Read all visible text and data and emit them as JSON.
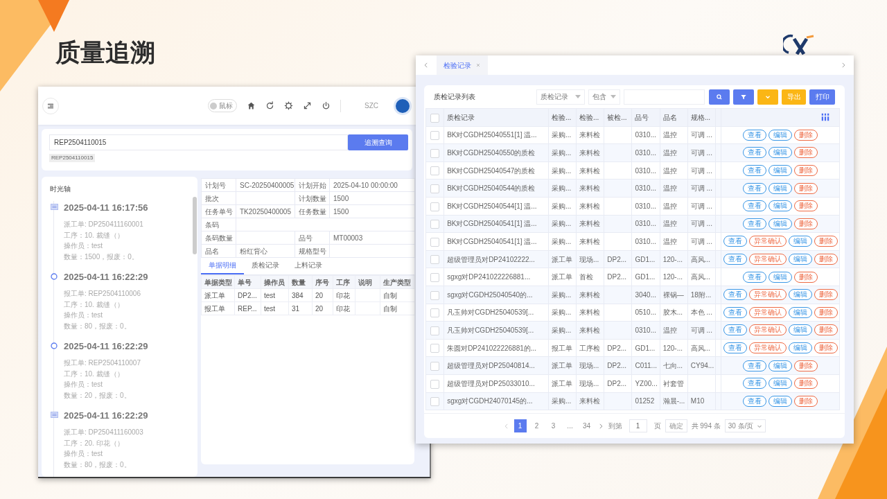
{
  "slide": {
    "title": "质量追溯"
  },
  "left_window": {
    "header": {
      "toggle": {
        "label": "鼠标",
        "on": false
      },
      "user": "SZC"
    },
    "search": {
      "value": "REP2504110015",
      "button": "追溯查询",
      "tags": [
        "REP2504110015"
      ]
    },
    "timeline": {
      "title": "时光轴",
      "items": [
        {
          "kind": "square",
          "time": "2025-04-11 16:17:56",
          "lines": [
            "派工单: DP250411160001",
            "工序：10. 裁缝（）",
            "操作员：test",
            "数量：1500，报废：0。"
          ]
        },
        {
          "kind": "circle",
          "time": "2025-04-11 16:22:29",
          "lines": [
            "报工单: REP2504110006",
            "工序：10. 裁缝（）",
            "操作员：test",
            "数量：80，报废：0。"
          ]
        },
        {
          "kind": "circle",
          "time": "2025-04-11 16:22:29",
          "lines": [
            "报工单: REP2504110007",
            "工序：10. 裁缝（）",
            "操作员：test",
            "数量：20，报废：0。"
          ]
        },
        {
          "kind": "square",
          "time": "2025-04-11 16:22:29",
          "lines": [
            "派工单: DP250411160003",
            "工序：20. 印花（）",
            "操作员：test",
            "数量：80，报废：0。"
          ]
        }
      ]
    },
    "info_table": {
      "rows": [
        [
          {
            "label": "计划号",
            "value": "SC-20250400005"
          },
          {
            "label": "计划开始",
            "value": "2025-04-10 00:00:00"
          }
        ],
        [
          {
            "label": "批次"
          },
          {
            "label": "计划数量",
            "value": "1500"
          }
        ],
        [
          {
            "label": "任务单号",
            "value": "TK20250400005"
          },
          {
            "label": "任务数量",
            "value": "1500"
          }
        ],
        [
          {
            "label": "条码"
          }
        ],
        [
          {
            "label": "条码数量"
          },
          {
            "label": "品号",
            "value": "MT00003"
          }
        ],
        [
          {
            "label": "品名",
            "value": "粉红背心"
          },
          {
            "label": "规格型号"
          }
        ]
      ]
    },
    "tabs": [
      {
        "label": "单据明细",
        "selected": true
      },
      {
        "label": "质检记录",
        "selected": false
      },
      {
        "label": "上料记录",
        "selected": false
      }
    ],
    "detail_table": {
      "columns": [
        "单据类型",
        "单号",
        "操作员",
        "数量",
        "序号",
        "工序",
        "说明",
        "生产类型"
      ],
      "rows": [
        [
          "派工单",
          "DP2...",
          "test",
          "384",
          "20",
          "印花",
          null,
          "自制"
        ],
        [
          "报工单",
          "REP...",
          "test",
          "31",
          "20",
          "印花",
          null,
          "自制"
        ]
      ]
    }
  },
  "right_window": {
    "tabs": [
      {
        "label": "检验记录",
        "selected": true
      }
    ],
    "toolbar": {
      "title": "质检记录列表",
      "field_select": "质检记录",
      "operator_select": "包含",
      "buttons": [
        {
          "kind": "search",
          "color": "#5b7bef"
        },
        {
          "kind": "filter",
          "color": "#5b7bef"
        },
        {
          "kind": "expand",
          "color": "#fbb615"
        },
        {
          "kind": "export",
          "label": "导出",
          "color": "#fbb615"
        },
        {
          "kind": "print",
          "label": "打印",
          "color": "#5b7bef"
        }
      ]
    },
    "table": {
      "select_all_checked": false,
      "columns": [
        "质检记录",
        "检验...",
        "检验...",
        "被检...",
        "品号",
        "品名",
        "规格..."
      ],
      "rows": [
        {
          "checked": false,
          "cells": [
            "BK对CGDH25040551[1] 温...",
            "采购...",
            "来料检",
            null,
            "0310...",
            "温控",
            "可调 ..."
          ],
          "actions": [
            {
              "label": "查看",
              "kind": "view"
            },
            {
              "label": "编辑",
              "kind": "edit"
            },
            {
              "label": "删除",
              "kind": "delete"
            }
          ]
        },
        {
          "checked": false,
          "cells": [
            "BK对CGDH25040550的质检",
            "采购...",
            "来料检",
            null,
            "0310...",
            "温控",
            "可调 ..."
          ],
          "actions": [
            {
              "label": "查看",
              "kind": "view"
            },
            {
              "label": "编辑",
              "kind": "edit"
            },
            {
              "label": "删除",
              "kind": "delete"
            }
          ]
        },
        {
          "checked": false,
          "cells": [
            "BK对CGDH25040547的质检",
            "采购...",
            "来料检",
            null,
            "0310...",
            "温控",
            "可调 ..."
          ],
          "actions": [
            {
              "label": "查看",
              "kind": "view"
            },
            {
              "label": "编辑",
              "kind": "edit"
            },
            {
              "label": "删除",
              "kind": "delete"
            }
          ]
        },
        {
          "checked": false,
          "cells": [
            "BK对CGDH25040544的质检",
            "采购...",
            "来料检",
            null,
            "0310...",
            "温控",
            "可调 ..."
          ],
          "actions": [
            {
              "label": "查看",
              "kind": "view"
            },
            {
              "label": "编辑",
              "kind": "edit"
            },
            {
              "label": "删除",
              "kind": "delete"
            }
          ]
        },
        {
          "checked": false,
          "cells": [
            "BK对CGDH25040544[1] 温...",
            "采购...",
            "来料检",
            null,
            "0310...",
            "温控",
            "可调 ..."
          ],
          "actions": [
            {
              "label": "查看",
              "kind": "view"
            },
            {
              "label": "编辑",
              "kind": "edit"
            },
            {
              "label": "删除",
              "kind": "delete"
            }
          ]
        },
        {
          "checked": false,
          "cells": [
            "BK对CGDH25040541[1] 温...",
            "采购...",
            "来料检",
            null,
            "0310...",
            "温控",
            "可调 ..."
          ],
          "actions": [
            {
              "label": "查看",
              "kind": "view"
            },
            {
              "label": "编辑",
              "kind": "edit"
            },
            {
              "label": "删除",
              "kind": "delete"
            }
          ]
        },
        {
          "checked": false,
          "cells": [
            "BK对CGDH25040541[1] 温...",
            "采购...",
            "来料检",
            null,
            "0310...",
            "温控",
            "可调 ..."
          ],
          "actions": [
            {
              "label": "查看",
              "kind": "view"
            },
            {
              "label": "异常确认",
              "kind": "confirm"
            },
            {
              "label": "编辑",
              "kind": "edit"
            },
            {
              "label": "删除",
              "kind": "delete"
            }
          ]
        },
        {
          "checked": false,
          "cells": [
            "超级管理员对DP24102222...",
            "派工单",
            "现场...",
            "DP2...",
            "GD1...",
            "120-...",
            "高风..."
          ],
          "actions": [
            {
              "label": "查看",
              "kind": "view"
            },
            {
              "label": "异常确认",
              "kind": "confirm"
            },
            {
              "label": "编辑",
              "kind": "edit"
            },
            {
              "label": "删除",
              "kind": "delete"
            }
          ]
        },
        {
          "checked": false,
          "cells": [
            "sgxg对DP241022226881...",
            "派工单",
            "首检",
            "DP2...",
            "GD1...",
            "120-...",
            "高风..."
          ],
          "actions": [
            {
              "label": "查看",
              "kind": "view"
            },
            {
              "label": "编辑",
              "kind": "edit"
            },
            {
              "label": "删除",
              "kind": "delete"
            }
          ]
        },
        {
          "checked": false,
          "cells": [
            "sgxg对CGDH25040540的...",
            "采购...",
            "来料检",
            null,
            "3040...",
            "裸锅—",
            "18附..."
          ],
          "actions": [
            {
              "label": "查看",
              "kind": "view"
            },
            {
              "label": "异常确认",
              "kind": "confirm"
            },
            {
              "label": "编辑",
              "kind": "edit"
            },
            {
              "label": "删除",
              "kind": "delete"
            }
          ]
        },
        {
          "checked": false,
          "cells": [
            "凡玉帅对CGDH25040539[...",
            "采购...",
            "来料检",
            null,
            "0510...",
            "胶木...",
            "本色 ..."
          ],
          "actions": [
            {
              "label": "查看",
              "kind": "view"
            },
            {
              "label": "异常确认",
              "kind": "confirm"
            },
            {
              "label": "编辑",
              "kind": "edit"
            },
            {
              "label": "删除",
              "kind": "delete"
            }
          ]
        },
        {
          "checked": false,
          "cells": [
            "凡玉帅对CGDH25040539[...",
            "采购...",
            "来料检",
            null,
            "0310...",
            "温控",
            "可调 ..."
          ],
          "actions": [
            {
              "label": "查看",
              "kind": "view"
            },
            {
              "label": "异常确认",
              "kind": "confirm"
            },
            {
              "label": "编辑",
              "kind": "edit"
            },
            {
              "label": "删除",
              "kind": "delete"
            }
          ]
        },
        {
          "checked": false,
          "cells": [
            "朱圆对DP241022226881的...",
            "报工单",
            "工序检",
            "DP2...",
            "GD1...",
            "120-...",
            "高风..."
          ],
          "actions": [
            {
              "label": "查看",
              "kind": "view"
            },
            {
              "label": "异常确认",
              "kind": "confirm"
            },
            {
              "label": "编辑",
              "kind": "edit"
            },
            {
              "label": "删除",
              "kind": "delete"
            }
          ]
        },
        {
          "checked": false,
          "cells": [
            "超级管理员对DP25040814...",
            "派工单",
            "现场...",
            "DP2...",
            "C011...",
            "七向...",
            "CY94..."
          ],
          "actions": [
            {
              "label": "查看",
              "kind": "view"
            },
            {
              "label": "编辑",
              "kind": "edit"
            },
            {
              "label": "删除",
              "kind": "delete"
            }
          ]
        },
        {
          "checked": false,
          "cells": [
            "超级管理员对DP25033010...",
            "派工单",
            "现场...",
            "DP2...",
            "YZ00...",
            "衬套管",
            null
          ],
          "actions": [
            {
              "label": "查看",
              "kind": "view"
            },
            {
              "label": "编辑",
              "kind": "edit"
            },
            {
              "label": "删除",
              "kind": "delete"
            }
          ]
        },
        {
          "checked": false,
          "cells": [
            "sgxg对CGDH24070145的...",
            "采购...",
            "来料检",
            null,
            "01252",
            "瀚晨-...",
            "M10"
          ],
          "actions": [
            {
              "label": "查看",
              "kind": "view"
            },
            {
              "label": "编辑",
              "kind": "edit"
            },
            {
              "label": "删除",
              "kind": "delete"
            }
          ]
        }
      ]
    },
    "pagination": {
      "pages": [
        {
          "label": "1",
          "selected": true
        },
        {
          "label": "2",
          "selected": false
        },
        {
          "label": "3",
          "selected": false
        },
        {
          "label": "...",
          "selected": false
        },
        {
          "label": "34",
          "selected": false
        }
      ],
      "goto_label": "到第",
      "goto_value": "1",
      "page_unit": "页",
      "confirm": "确定",
      "total": "共 994 条",
      "page_size": "30 条/页"
    }
  }
}
